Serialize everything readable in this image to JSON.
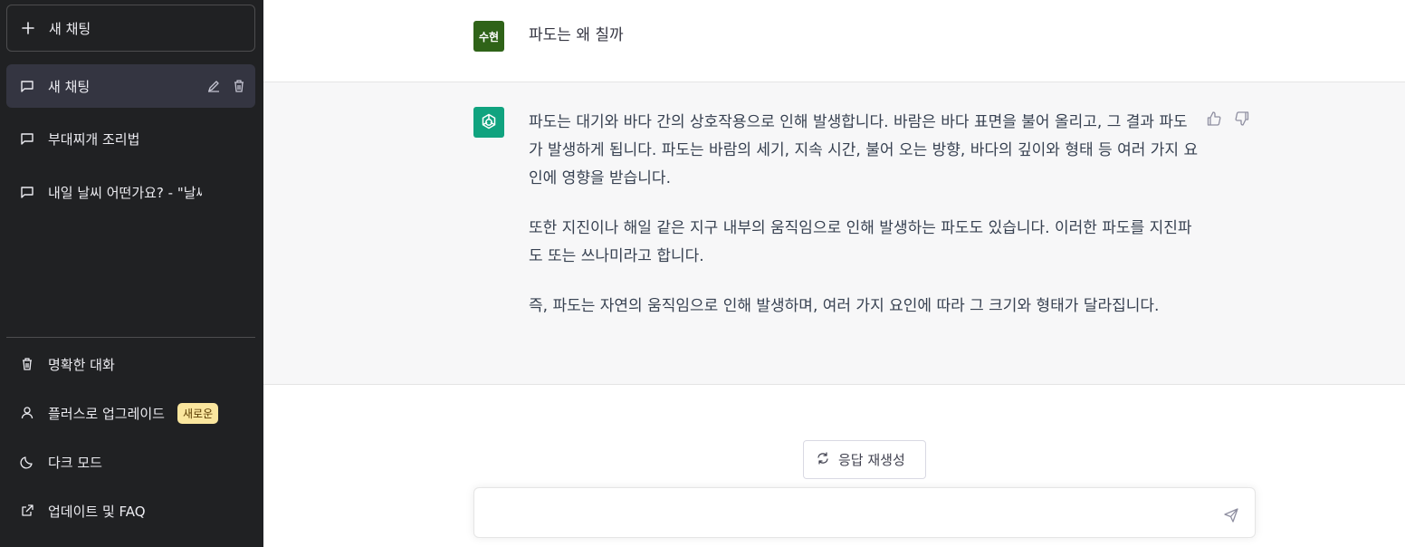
{
  "sidebar": {
    "new_chat_label": "새 채팅",
    "conversations": [
      {
        "label": "새 채팅",
        "active": true
      },
      {
        "label": "부대찌개 조리법",
        "active": false
      },
      {
        "label": "내일 날씨 어떤가요? - \"날씨",
        "active": false
      }
    ],
    "bottom": {
      "clear": "명확한 대화",
      "upgrade": "플러스로 업그레이드",
      "upgrade_badge": "새로운",
      "dark_mode": "다크 모드",
      "faq": "업데이트 및 FAQ"
    }
  },
  "chat": {
    "user_avatar_text": "수현",
    "user_message": "파도는 왜 칠까",
    "bot_paragraphs": [
      "파도는 대기와 바다 간의 상호작용으로 인해 발생합니다. 바람은 바다 표면을 불어 올리고, 그 결과 파도가 발생하게 됩니다. 파도는 바람의 세기, 지속 시간, 불어 오는 방향, 바다의 깊이와 형태 등 여러 가지 요인에 영향을 받습니다.",
      "또한 지진이나 해일 같은 지구 내부의 움직임으로 인해 발생하는 파도도 있습니다. 이러한 파도를 지진파도 또는 쓰나미라고 합니다.",
      "즉, 파도는 자연의 움직임으로 인해 발생하며, 여러 가지 요인에 따라 그 크기와 형태가 달라집니다."
    ]
  },
  "regenerate_label": "응답 재생성",
  "input": {
    "value": "",
    "placeholder": ""
  },
  "colors": {
    "sidebar_bg": "#202123",
    "user_avatar_bg": "#2f6318",
    "bot_avatar_bg": "#10a37f",
    "badge_bg": "#fae69e"
  }
}
